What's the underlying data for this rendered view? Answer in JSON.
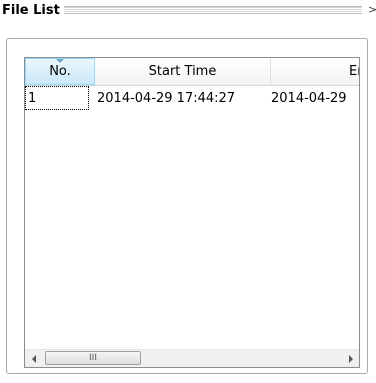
{
  "window": {
    "title": "File List",
    "close_glyph": ">"
  },
  "list": {
    "columns": [
      {
        "label": "No."
      },
      {
        "label": "Start Time"
      },
      {
        "label": "End T"
      }
    ],
    "rows": [
      {
        "no": "1",
        "start_time": "2014-04-29 17:44:27",
        "end_time": "2014-04-29"
      }
    ]
  },
  "scrollbar": {
    "grip_glyph": "III"
  }
}
